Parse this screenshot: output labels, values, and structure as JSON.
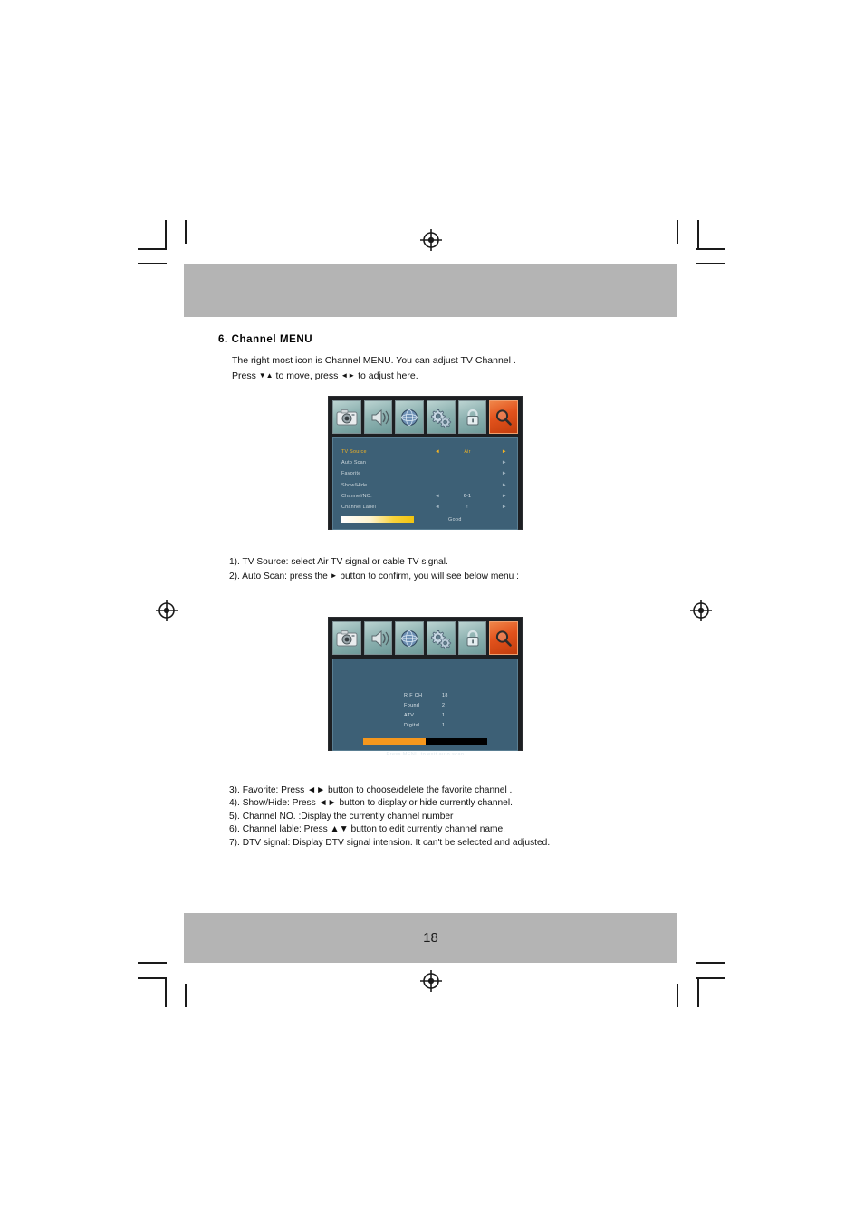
{
  "page": {
    "number": "18"
  },
  "section": {
    "title": "6. Channel  MENU",
    "intro_line1": "The right most icon is Channel MENU. You can adjust TV Channel .",
    "intro_line2_a": "Press",
    "intro_line2_arrows1": "▼▲",
    "intro_line2_b": "to move, press",
    "intro_line2_arrows2": "◄►",
    "intro_line2_c": "to adjust here."
  },
  "mid_notes": {
    "line1": "1). TV Source: select Air TV signal or cable TV signal.",
    "line2_a": "2). Auto Scan: press the",
    "line2_arrow": "►",
    "line2_b": "button to confirm, you will see below menu :"
  },
  "notes": {
    "items": [
      "3). Favorite: Press ◄► button to choose/delete the favorite channel .",
      "4). Show/Hide: Press ◄► button to display  or hide currently channel.",
      "5). Channel NO.  :Display  the currently channel number",
      "6). Channel lable: Press ▲▼ button to edit currently channel name.",
      "7). DTV signal: Display DTV signal intension. It can't be selected and  adjusted."
    ]
  },
  "osd_channel": {
    "tabs": [
      {
        "name": "picture-icon",
        "active": false
      },
      {
        "name": "audio-icon",
        "active": false
      },
      {
        "name": "setup-globe-icon",
        "active": false
      },
      {
        "name": "function-gears-icon",
        "active": false
      },
      {
        "name": "lock-icon",
        "active": false
      },
      {
        "name": "channel-search-icon",
        "active": true
      }
    ],
    "rows": [
      {
        "label": "TV Source",
        "left": "◄",
        "value": "Air",
        "right": "►",
        "selected": true
      },
      {
        "label": "Auto Scan",
        "left": "",
        "value": "",
        "right": "►",
        "selected": false
      },
      {
        "label": "Favorite",
        "left": "",
        "value": "",
        "right": "►",
        "selected": false
      },
      {
        "label": "Show/Hide",
        "left": "",
        "value": "",
        "right": "►",
        "selected": false
      },
      {
        "label": "Channel/NO.",
        "left": "◄",
        "value": "6-1",
        "right": "►",
        "selected": false
      },
      {
        "label": "Channel Label",
        "left": "◄",
        "value": "!",
        "right": "►",
        "selected": false
      }
    ],
    "signal_quality": "Good",
    "signal_level_percent": 100,
    "colors": {
      "highlight": "#f2b323",
      "panel": "#3d6076",
      "active_tab": "#e2521c"
    }
  },
  "osd_scan": {
    "tabs": [
      {
        "name": "picture-icon",
        "active": false
      },
      {
        "name": "audio-icon",
        "active": false
      },
      {
        "name": "setup-globe-icon",
        "active": false
      },
      {
        "name": "function-gears-icon",
        "active": false
      },
      {
        "name": "lock-icon",
        "active": false
      },
      {
        "name": "channel-search-icon",
        "active": true
      }
    ],
    "rows": [
      {
        "key": "R F  CH",
        "value": "18"
      },
      {
        "key": "Found",
        "value": "2"
      },
      {
        "key": "ATV",
        "value": "1"
      },
      {
        "key": "Digital",
        "value": "1"
      }
    ],
    "progress_percent": 50,
    "hint": "Press  MENU  to  exit  auto scan",
    "colors": {
      "progress_fill": "#f5971d",
      "progress_track": "#000000"
    }
  }
}
